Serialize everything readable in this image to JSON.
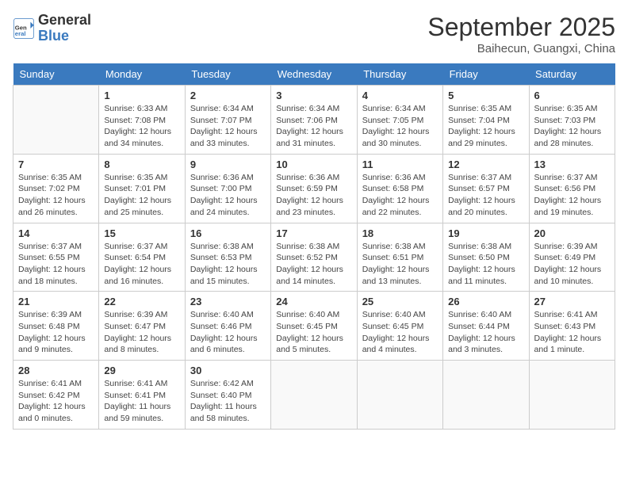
{
  "header": {
    "logo_general": "General",
    "logo_blue": "Blue",
    "month_title": "September 2025",
    "location": "Baihecun, Guangxi, China"
  },
  "days_of_week": [
    "Sunday",
    "Monday",
    "Tuesday",
    "Wednesday",
    "Thursday",
    "Friday",
    "Saturday"
  ],
  "weeks": [
    [
      {
        "num": "",
        "sunrise": "",
        "sunset": "",
        "daylight": ""
      },
      {
        "num": "1",
        "sunrise": "Sunrise: 6:33 AM",
        "sunset": "Sunset: 7:08 PM",
        "daylight": "Daylight: 12 hours and 34 minutes."
      },
      {
        "num": "2",
        "sunrise": "Sunrise: 6:34 AM",
        "sunset": "Sunset: 7:07 PM",
        "daylight": "Daylight: 12 hours and 33 minutes."
      },
      {
        "num": "3",
        "sunrise": "Sunrise: 6:34 AM",
        "sunset": "Sunset: 7:06 PM",
        "daylight": "Daylight: 12 hours and 31 minutes."
      },
      {
        "num": "4",
        "sunrise": "Sunrise: 6:34 AM",
        "sunset": "Sunset: 7:05 PM",
        "daylight": "Daylight: 12 hours and 30 minutes."
      },
      {
        "num": "5",
        "sunrise": "Sunrise: 6:35 AM",
        "sunset": "Sunset: 7:04 PM",
        "daylight": "Daylight: 12 hours and 29 minutes."
      },
      {
        "num": "6",
        "sunrise": "Sunrise: 6:35 AM",
        "sunset": "Sunset: 7:03 PM",
        "daylight": "Daylight: 12 hours and 28 minutes."
      }
    ],
    [
      {
        "num": "7",
        "sunrise": "Sunrise: 6:35 AM",
        "sunset": "Sunset: 7:02 PM",
        "daylight": "Daylight: 12 hours and 26 minutes."
      },
      {
        "num": "8",
        "sunrise": "Sunrise: 6:35 AM",
        "sunset": "Sunset: 7:01 PM",
        "daylight": "Daylight: 12 hours and 25 minutes."
      },
      {
        "num": "9",
        "sunrise": "Sunrise: 6:36 AM",
        "sunset": "Sunset: 7:00 PM",
        "daylight": "Daylight: 12 hours and 24 minutes."
      },
      {
        "num": "10",
        "sunrise": "Sunrise: 6:36 AM",
        "sunset": "Sunset: 6:59 PM",
        "daylight": "Daylight: 12 hours and 23 minutes."
      },
      {
        "num": "11",
        "sunrise": "Sunrise: 6:36 AM",
        "sunset": "Sunset: 6:58 PM",
        "daylight": "Daylight: 12 hours and 22 minutes."
      },
      {
        "num": "12",
        "sunrise": "Sunrise: 6:37 AM",
        "sunset": "Sunset: 6:57 PM",
        "daylight": "Daylight: 12 hours and 20 minutes."
      },
      {
        "num": "13",
        "sunrise": "Sunrise: 6:37 AM",
        "sunset": "Sunset: 6:56 PM",
        "daylight": "Daylight: 12 hours and 19 minutes."
      }
    ],
    [
      {
        "num": "14",
        "sunrise": "Sunrise: 6:37 AM",
        "sunset": "Sunset: 6:55 PM",
        "daylight": "Daylight: 12 hours and 18 minutes."
      },
      {
        "num": "15",
        "sunrise": "Sunrise: 6:37 AM",
        "sunset": "Sunset: 6:54 PM",
        "daylight": "Daylight: 12 hours and 16 minutes."
      },
      {
        "num": "16",
        "sunrise": "Sunrise: 6:38 AM",
        "sunset": "Sunset: 6:53 PM",
        "daylight": "Daylight: 12 hours and 15 minutes."
      },
      {
        "num": "17",
        "sunrise": "Sunrise: 6:38 AM",
        "sunset": "Sunset: 6:52 PM",
        "daylight": "Daylight: 12 hours and 14 minutes."
      },
      {
        "num": "18",
        "sunrise": "Sunrise: 6:38 AM",
        "sunset": "Sunset: 6:51 PM",
        "daylight": "Daylight: 12 hours and 13 minutes."
      },
      {
        "num": "19",
        "sunrise": "Sunrise: 6:38 AM",
        "sunset": "Sunset: 6:50 PM",
        "daylight": "Daylight: 12 hours and 11 minutes."
      },
      {
        "num": "20",
        "sunrise": "Sunrise: 6:39 AM",
        "sunset": "Sunset: 6:49 PM",
        "daylight": "Daylight: 12 hours and 10 minutes."
      }
    ],
    [
      {
        "num": "21",
        "sunrise": "Sunrise: 6:39 AM",
        "sunset": "Sunset: 6:48 PM",
        "daylight": "Daylight: 12 hours and 9 minutes."
      },
      {
        "num": "22",
        "sunrise": "Sunrise: 6:39 AM",
        "sunset": "Sunset: 6:47 PM",
        "daylight": "Daylight: 12 hours and 8 minutes."
      },
      {
        "num": "23",
        "sunrise": "Sunrise: 6:40 AM",
        "sunset": "Sunset: 6:46 PM",
        "daylight": "Daylight: 12 hours and 6 minutes."
      },
      {
        "num": "24",
        "sunrise": "Sunrise: 6:40 AM",
        "sunset": "Sunset: 6:45 PM",
        "daylight": "Daylight: 12 hours and 5 minutes."
      },
      {
        "num": "25",
        "sunrise": "Sunrise: 6:40 AM",
        "sunset": "Sunset: 6:45 PM",
        "daylight": "Daylight: 12 hours and 4 minutes."
      },
      {
        "num": "26",
        "sunrise": "Sunrise: 6:40 AM",
        "sunset": "Sunset: 6:44 PM",
        "daylight": "Daylight: 12 hours and 3 minutes."
      },
      {
        "num": "27",
        "sunrise": "Sunrise: 6:41 AM",
        "sunset": "Sunset: 6:43 PM",
        "daylight": "Daylight: 12 hours and 1 minute."
      }
    ],
    [
      {
        "num": "28",
        "sunrise": "Sunrise: 6:41 AM",
        "sunset": "Sunset: 6:42 PM",
        "daylight": "Daylight: 12 hours and 0 minutes."
      },
      {
        "num": "29",
        "sunrise": "Sunrise: 6:41 AM",
        "sunset": "Sunset: 6:41 PM",
        "daylight": "Daylight: 11 hours and 59 minutes."
      },
      {
        "num": "30",
        "sunrise": "Sunrise: 6:42 AM",
        "sunset": "Sunset: 6:40 PM",
        "daylight": "Daylight: 11 hours and 58 minutes."
      },
      {
        "num": "",
        "sunrise": "",
        "sunset": "",
        "daylight": ""
      },
      {
        "num": "",
        "sunrise": "",
        "sunset": "",
        "daylight": ""
      },
      {
        "num": "",
        "sunrise": "",
        "sunset": "",
        "daylight": ""
      },
      {
        "num": "",
        "sunrise": "",
        "sunset": "",
        "daylight": ""
      }
    ]
  ]
}
